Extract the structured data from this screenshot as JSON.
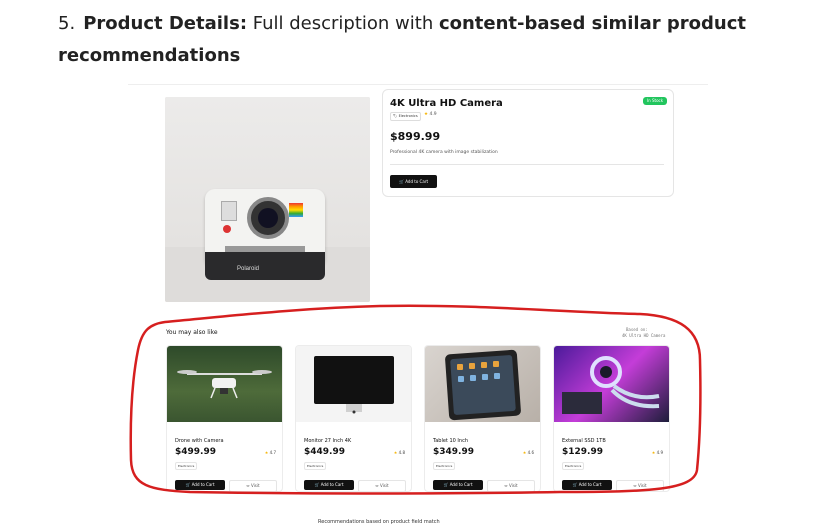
{
  "heading": {
    "number": "5.",
    "bold_lead": "Product Details:",
    "text_mid": " Full description with ",
    "bold_tail": "content-based similar product recommendations"
  },
  "product": {
    "title": "4K Ultra HD Camera",
    "stock_badge": "In Stock",
    "category": "Electronics",
    "rating": "4.9",
    "price": "$899.99",
    "description": "Professional 4K camera with image stabilization",
    "add_to_cart": "Add to Cart",
    "image_brand": "Polaroid"
  },
  "recommendations": {
    "title": "You may also like",
    "based_on_label": "Based on:",
    "based_on_value": "4K Ultra HD Camera",
    "items": [
      {
        "name": "Drone with Camera",
        "price": "$499.99",
        "rating": "4.7",
        "category": "Electronics",
        "cart": "Add to Cart",
        "visit": "Visit"
      },
      {
        "name": "Monitor 27 Inch 4K",
        "price": "$449.99",
        "rating": "4.8",
        "category": "Electronics",
        "cart": "Add to Cart",
        "visit": "Visit"
      },
      {
        "name": "Tablet 10 Inch",
        "price": "$349.99",
        "rating": "4.6",
        "category": "Electronics",
        "cart": "Add to Cart",
        "visit": "Visit"
      },
      {
        "name": "External SSD 1TB",
        "price": "$129.99",
        "rating": "4.9",
        "category": "Electronics",
        "cart": "Add to Cart",
        "visit": "Visit"
      }
    ]
  },
  "footer": "Recommendations based on product field match",
  "colors": {
    "accent_green": "#22c55e",
    "button_dark": "#111111",
    "annotation_red": "#d61f1f",
    "star": "#f5b301"
  }
}
